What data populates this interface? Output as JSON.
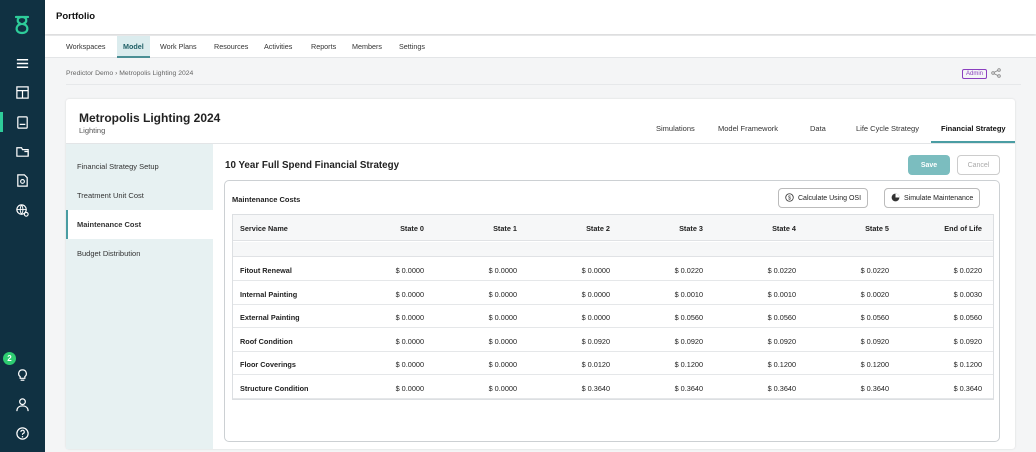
{
  "app": {
    "title": "Portfolio",
    "sidebar_badge_count": "2"
  },
  "sidebar": {
    "items": [
      {
        "name": "menu-icon"
      },
      {
        "name": "dashboard-icon"
      },
      {
        "name": "model-icon"
      },
      {
        "name": "folders-icon"
      },
      {
        "name": "reports-icon"
      },
      {
        "name": "globe-settings-icon"
      },
      {
        "name": "lightbulb-icon"
      },
      {
        "name": "user-icon"
      },
      {
        "name": "help-icon"
      }
    ]
  },
  "nav": {
    "tabs": [
      "Workspaces",
      "Model",
      "Work Plans",
      "Resources",
      "Activities",
      "Reports",
      "Members",
      "Settings"
    ],
    "active": "Model"
  },
  "breadcrumb": "Predictor Demo › Metropolis Lighting 2024",
  "role_badge": "Admin",
  "model": {
    "title": "Metropolis Lighting 2024",
    "subtitle": "Lighting"
  },
  "sub_tabs": [
    "Simulations",
    "Model Framework",
    "Data",
    "Life Cycle Strategy",
    "Financial Strategy"
  ],
  "left_nav": [
    "Financial Strategy Setup",
    "Treatment Unit Cost",
    "Maintenance Cost",
    "Budget Distribution"
  ],
  "strategy": {
    "title": "10 Year Full Spend Financial Strategy",
    "save": "Save",
    "cancel": "Cancel"
  },
  "maintenance": {
    "title": "Maintenance Costs",
    "calc_button": "Calculate Using OSI",
    "sim_button": "Simulate Maintenance",
    "columns": [
      "Service Name",
      "State 0",
      "State 1",
      "State 2",
      "State 3",
      "State 4",
      "State 5",
      "End of Life"
    ],
    "rows": [
      [
        "Fitout Renewal",
        "$ 0.0000",
        "$ 0.0000",
        "$ 0.0000",
        "$ 0.0220",
        "$ 0.0220",
        "$ 0.0220",
        "$ 0.0220"
      ],
      [
        "Internal Painting",
        "$ 0.0000",
        "$ 0.0000",
        "$ 0.0000",
        "$ 0.0010",
        "$ 0.0010",
        "$ 0.0020",
        "$ 0.0030"
      ],
      [
        "External Painting",
        "$ 0.0000",
        "$ 0.0000",
        "$ 0.0000",
        "$ 0.0560",
        "$ 0.0560",
        "$ 0.0560",
        "$ 0.0560"
      ],
      [
        "Roof Condition",
        "$ 0.0000",
        "$ 0.0000",
        "$ 0.0920",
        "$ 0.0920",
        "$ 0.0920",
        "$ 0.0920",
        "$ 0.0920"
      ],
      [
        "Floor Coverings",
        "$ 0.0000",
        "$ 0.0000",
        "$ 0.0120",
        "$ 0.1200",
        "$ 0.1200",
        "$ 0.1200",
        "$ 0.1200"
      ],
      [
        "Structure Condition",
        "$ 0.0000",
        "$ 0.0000",
        "$ 0.3640",
        "$ 0.3640",
        "$ 0.3640",
        "$ 0.3640",
        "$ 0.3640"
      ]
    ]
  },
  "colors": {
    "sidebar": "#103142",
    "accent": "#4a9da3",
    "save": "#7bbdbf",
    "admin": "#8b3fbf",
    "badge": "#2ecc71"
  }
}
